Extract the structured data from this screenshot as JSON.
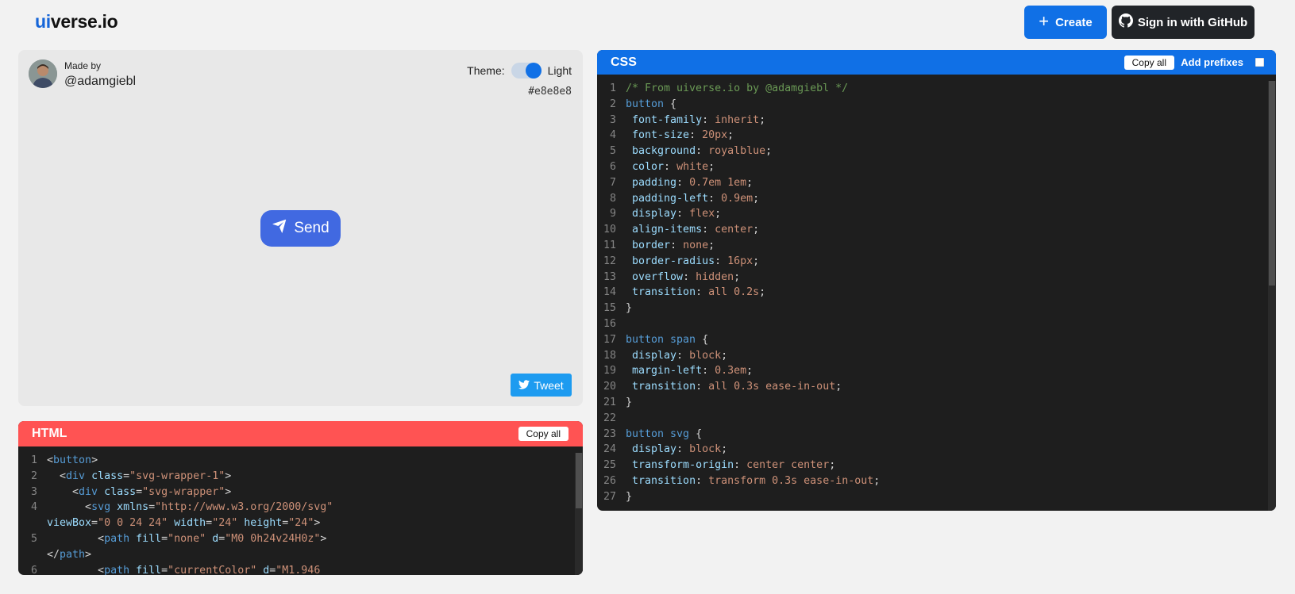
{
  "header": {
    "logo_ui": "ui",
    "logo_rest": "verse.io",
    "create_label": "Create",
    "github_label": "Sign in with GitHub"
  },
  "preview": {
    "made_by": "Made by",
    "author": "@adamgiebl",
    "theme_label": "Theme:",
    "theme_value": "Light",
    "bg_hex": "#e8e8e8",
    "send_label": "Send",
    "tweet_label": "Tweet",
    "button_color": "#4169e1",
    "background_color": "#e8e8e8"
  },
  "css_panel": {
    "title": "CSS",
    "copy_label": "Copy all",
    "add_prefixes_label": "Add prefixes",
    "lines": [
      "/* From uiverse.io by @adamgiebl */",
      "button {",
      " font-family: inherit;",
      " font-size: 20px;",
      " background: royalblue;",
      " color: white;",
      " padding: 0.7em 1em;",
      " padding-left: 0.9em;",
      " display: flex;",
      " align-items: center;",
      " border: none;",
      " border-radius: 16px;",
      " overflow: hidden;",
      " transition: all 0.2s;",
      "}",
      "",
      "button span {",
      " display: block;",
      " margin-left: 0.3em;",
      " transition: all 0.3s ease-in-out;",
      "}",
      "",
      "button svg {",
      " display: block;",
      " transform-origin: center center;",
      " transition: transform 0.3s ease-in-out;",
      "}"
    ]
  },
  "html_panel": {
    "title": "HTML",
    "copy_label": "Copy all",
    "lines": [
      "<button>",
      "  <div class=\"svg-wrapper-1\">",
      "    <div class=\"svg-wrapper\">",
      "      <svg xmlns=\"http://www.w3.org/2000/svg\" viewBox=\"0 0 24 24\" width=\"24\" height=\"24\">",
      "        <path fill=\"none\" d=\"M0 0h24v24H0z\"></path>",
      "        <path fill=\"currentColor\" d=\"M1.946"
    ]
  },
  "colors": {
    "accent": "#1070e6",
    "html_header": "#ff5353",
    "code_bg": "#1e1e1e",
    "github_btn": "#212428",
    "tweet": "#1d9bf0"
  }
}
